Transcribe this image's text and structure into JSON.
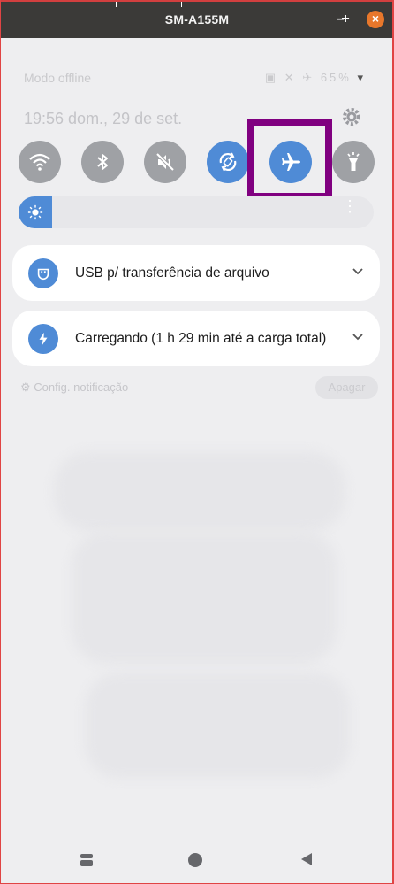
{
  "window": {
    "title": "SM-A155M",
    "minimize_label": "–",
    "maximize_label": "+",
    "close_label": "×"
  },
  "status_bar": {
    "mode_text": "Modo offline",
    "battery_text": "65%",
    "icons": [
      "nfc-icon",
      "mute-icon",
      "airplane-small-icon",
      "battery-icon"
    ]
  },
  "datetime": "19:56  dom., 29 de set.",
  "quick_toggles": [
    {
      "name": "wifi",
      "icon": "wifi-icon",
      "active": false
    },
    {
      "name": "bluetooth",
      "icon": "bluetooth-icon",
      "active": false
    },
    {
      "name": "sound",
      "icon": "mute-icon",
      "active": false
    },
    {
      "name": "auto-rotate",
      "icon": "rotate-icon",
      "active": true
    },
    {
      "name": "airplane-mode",
      "icon": "airplane-icon",
      "active": true
    },
    {
      "name": "flashlight",
      "icon": "flashlight-icon",
      "active": false
    }
  ],
  "brightness": {
    "level": 0.08,
    "more_label": "⋮"
  },
  "notifications": [
    {
      "icon": "usb-icon",
      "text": "USB p/ transferência de arquivo"
    },
    {
      "icon": "bolt-icon",
      "text": "Carregando (1 h 29 min até a carga total)"
    }
  ],
  "notif_settings_label": "Config. notificação",
  "clear_label": "Apagar",
  "colors": {
    "accent": "#4f8bd6",
    "highlight": "#800080",
    "titlebar": "#3b3a38",
    "close": "#e8772b"
  }
}
